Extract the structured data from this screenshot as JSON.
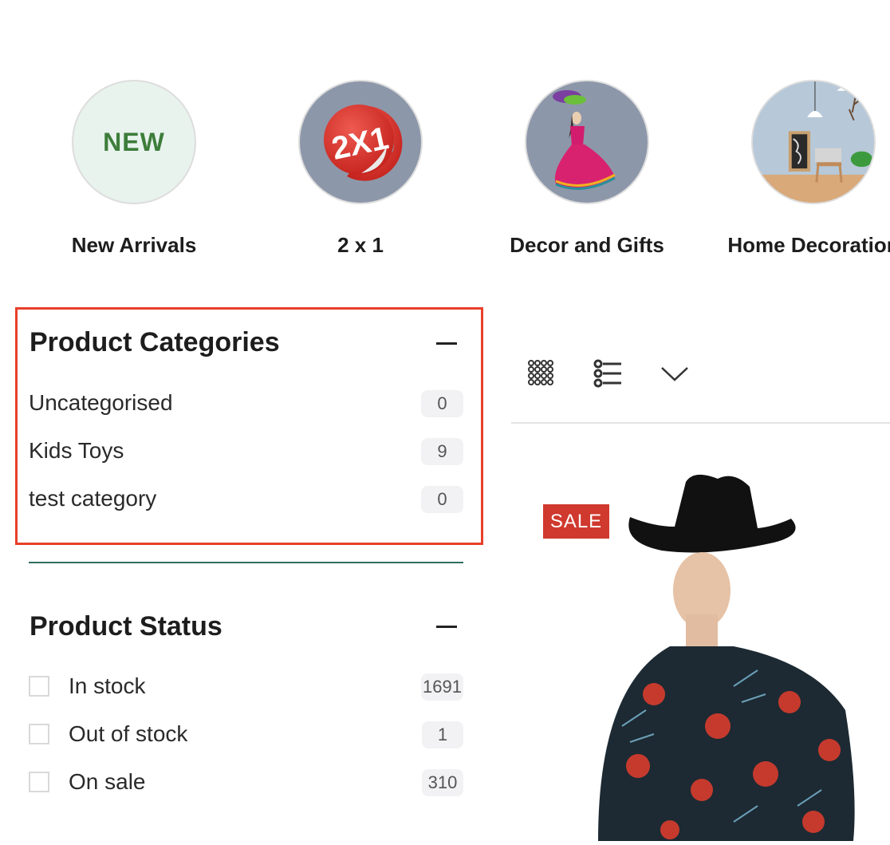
{
  "categories_strip": [
    {
      "label": "New Arrivals",
      "badge_text": "NEW",
      "icon": "new-badge-icon"
    },
    {
      "label": "2 x 1",
      "badge_text": "2X1",
      "icon": "sticker-2x1-icon"
    },
    {
      "label": "Decor and Gifts",
      "icon": "doll-image"
    },
    {
      "label": "Home Decoration",
      "icon": "room-image"
    }
  ],
  "product_categories": {
    "title": "Product Categories",
    "collapse_icon": "minus-icon",
    "items": [
      {
        "name": "Uncategorised",
        "count": "0"
      },
      {
        "name": "Kids Toys",
        "count": "9"
      },
      {
        "name": "test category",
        "count": "0"
      }
    ]
  },
  "product_status": {
    "title": "Product Status",
    "collapse_icon": "minus-icon",
    "items": [
      {
        "name": "In stock",
        "count": "1691",
        "checked": false
      },
      {
        "name": "Out of stock",
        "count": "1",
        "checked": false
      },
      {
        "name": "On sale",
        "count": "310",
        "checked": false
      }
    ]
  },
  "toolbar": {
    "grid_view_icon": "grid-view-icon",
    "list_view_icon": "list-view-icon",
    "sort_icon": "chevron-down-icon"
  },
  "product": {
    "badge": "SALE",
    "image": "man-cowboy-hat-floral-shirt"
  },
  "colors": {
    "highlight_border": "#e8402a",
    "sale_badge": "#d0392e",
    "divider": "#2f6e62",
    "new_text": "#3d7d3a"
  }
}
